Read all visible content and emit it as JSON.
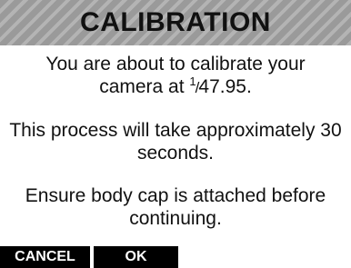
{
  "dialog": {
    "title": "CALIBRATION",
    "line1a": "You are about to calibrate your",
    "line1b_prefix": "camera at ",
    "shutter_numerator": "1",
    "shutter_slash": "/",
    "shutter_denominator": "47.95",
    "line1b_suffix": ".",
    "paragraph2": "This process will take approximately 30 seconds.",
    "paragraph3": "Ensure body cap is attached before continuing."
  },
  "softkeys": {
    "cancel_label": "CANCEL",
    "ok_label": "OK"
  },
  "colors": {
    "title_stripe_dark": "#9a9a9a",
    "title_stripe_light": "#b4b4b4",
    "softkey_background": "#000000",
    "softkey_text": "#ffffff"
  }
}
